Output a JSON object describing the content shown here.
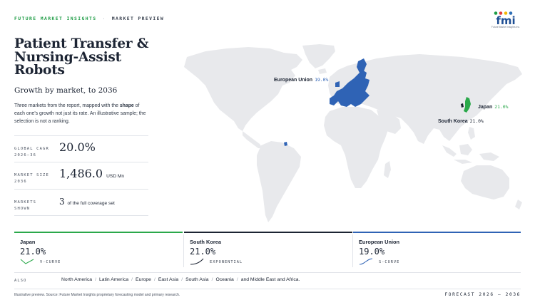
{
  "header": {
    "brand": "FUTURE MARKET INSIGHTS",
    "separator": "·",
    "section": "MARKET PREVIEW"
  },
  "logo": {
    "text": "fmi",
    "subtext": "Future Market Insights Inc.",
    "colors": [
      "#1e9c45",
      "#e23b3b",
      "#2d6fb7",
      "#f2b705"
    ]
  },
  "title": "Patient Transfer & Nursing-Assist Robots",
  "subtitle": "Growth by market, to 2036",
  "description": {
    "part1": "Three markets from the report, mapped with the ",
    "bold": "shape",
    "part2": " of each one's growth not just its rate. An illustrative sample; the selection is not a ranking."
  },
  "stats": [
    {
      "label_line1": "GLOBAL CAGR",
      "label_line2": "2026–36",
      "value": "20.0%",
      "unit": ""
    },
    {
      "label_line1": "MARKET SIZE",
      "label_line2": "2036",
      "value": "1,486.0",
      "unit": "USD Mn"
    },
    {
      "label_line1": "MARKETS",
      "label_line2": "SHOWN",
      "value": "3",
      "unit": "of the full coverage set"
    }
  ],
  "map_labels": {
    "eu": {
      "name": "European Union",
      "value": "19.0%"
    },
    "japan": {
      "name": "Japan",
      "value": "21.0%"
    },
    "korea": {
      "name": "South Korea",
      "value": "21.0%"
    }
  },
  "markets": [
    {
      "name": "Japan",
      "value": "21.0%",
      "shape": "V-CURVE",
      "color": "#2aa84a"
    },
    {
      "name": "South Korea",
      "value": "21.0%",
      "shape": "EXPONENTIAL",
      "color": "#1c2433"
    },
    {
      "name": "European Union",
      "value": "19.0%",
      "shape": "S-CURVE",
      "color": "#2f63b5"
    }
  ],
  "also": {
    "label": "ALSO",
    "regions": [
      "North America",
      "Latin America",
      "Europe",
      "East Asia",
      "South Asia",
      "Oceania",
      "and Middle East and Africa."
    ]
  },
  "footer": {
    "note": "Illustrative preview. Source: Future Market Insights proprietary forecasting model and primary research.",
    "forecast": "FORECAST 2026 – 2036"
  },
  "colors": {
    "land": "#e8e9ec",
    "eu": "#2f63b5",
    "japan": "#2aa84a",
    "korea": "#1c2433",
    "accent": "#1e9c45"
  }
}
